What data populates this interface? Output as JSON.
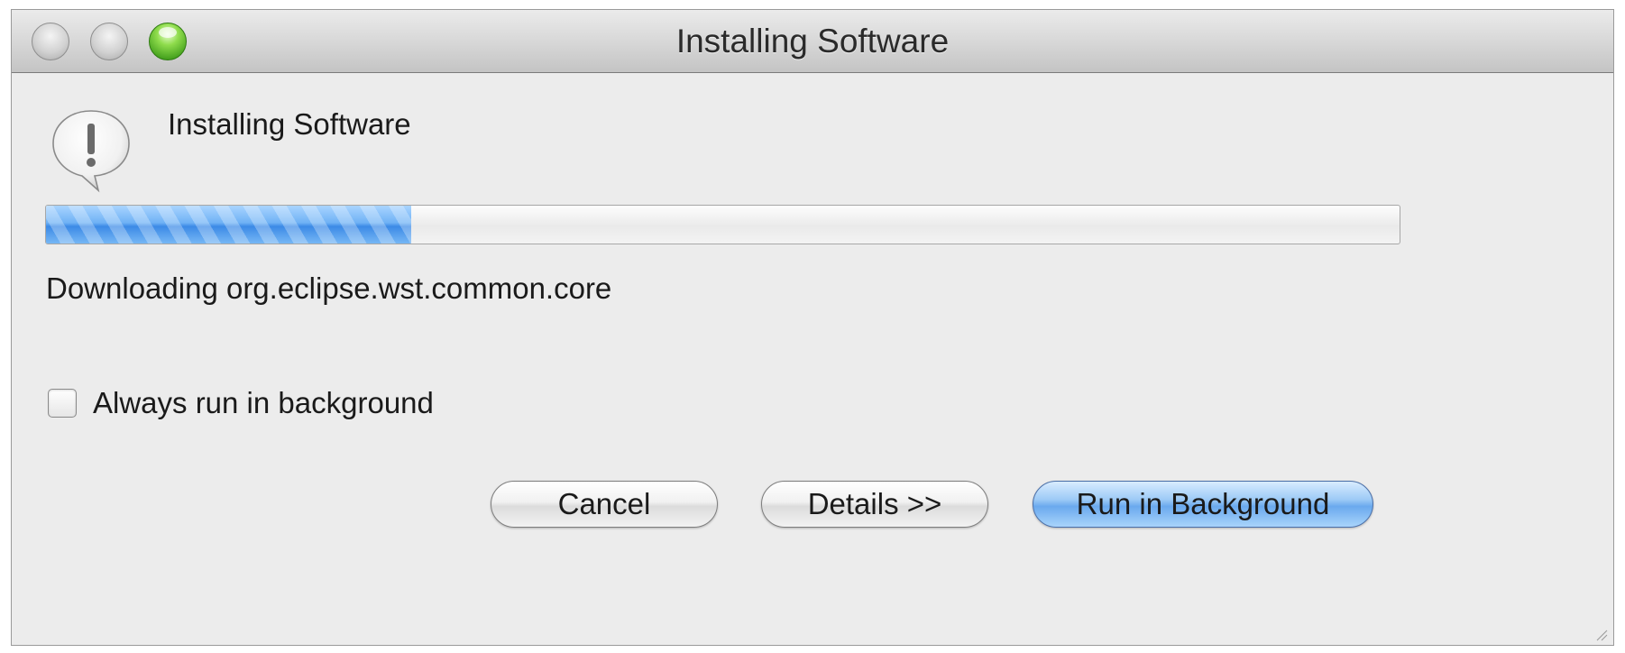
{
  "window": {
    "title": "Installing Software"
  },
  "dialog": {
    "header": "Installing Software",
    "icon": "alert-exclamation-icon",
    "progress": {
      "fraction": 0.27
    },
    "status": "Downloading org.eclipse.wst.common.core",
    "checkbox": {
      "label": "Always run in background",
      "checked": false
    },
    "buttons": {
      "cancel": "Cancel",
      "details": "Details >>",
      "run_in_background": "Run in Background"
    }
  },
  "colors": {
    "progress_fill": "#4a95ea",
    "default_button": "#7fb7f2",
    "window_background": "#ececec"
  }
}
